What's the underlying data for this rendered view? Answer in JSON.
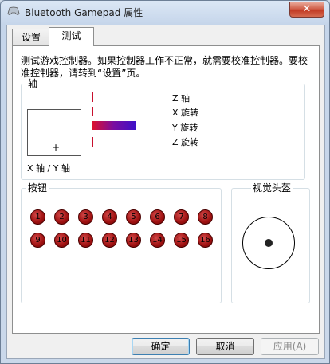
{
  "window": {
    "title": "Bluetooth Gamepad 属性",
    "close_label": "✕"
  },
  "tabs": [
    {
      "label": "设置"
    },
    {
      "label": "测试"
    }
  ],
  "test": {
    "description": "测试游戏控制器。如果控制器工作不正常，就需要校准控制器。要校准控制器，请转到“设置”页。",
    "axes_group": {
      "label": "轴",
      "xy_label": "X 轴 / Y 轴",
      "axis_labels": [
        "Z 轴",
        "X 旋转",
        "Y 旋转",
        "Z 旋转"
      ]
    },
    "buttons_group": {
      "label": "按钮",
      "buttons": [
        "1",
        "2",
        "3",
        "4",
        "5",
        "6",
        "7",
        "8",
        "9",
        "10",
        "11",
        "12",
        "13",
        "14",
        "15",
        "16"
      ]
    },
    "pov_group": {
      "label": "视觉头盔"
    }
  },
  "footer": {
    "ok": "确定",
    "cancel": "取消",
    "apply": "应用(A)"
  },
  "colors": {
    "axis_bar_start": "#e0102a",
    "axis_bar_end": "#3e10c8",
    "button_red": "#9e1010"
  },
  "icons": {
    "app": "gamepad-icon",
    "close": "close-icon"
  }
}
